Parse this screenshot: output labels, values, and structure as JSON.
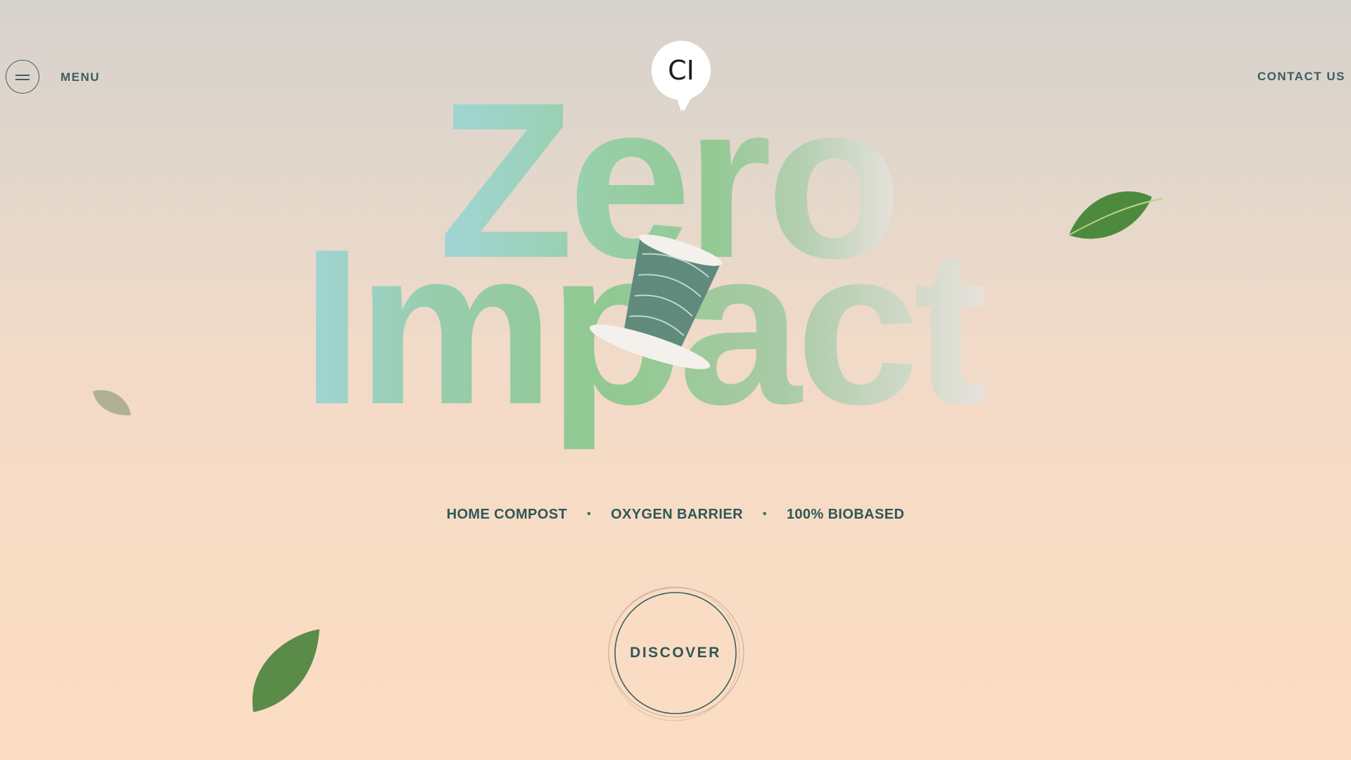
{
  "header": {
    "menu_label": "MENU",
    "contact_label": "CONTACT US",
    "logo_text": "CI"
  },
  "hero": {
    "line1": "Zero",
    "line2": "Impact"
  },
  "features": [
    "HOME COMPOST",
    "OXYGEN BARRIER",
    "100% BIOBASED"
  ],
  "cta": {
    "label": "DISCOVER"
  },
  "colors": {
    "text": "#2e5556",
    "headline_teal": "#9ed4d2",
    "headline_green": "#8fca91",
    "capsule": "#5d8a7a",
    "leaf": "#4f8a3e"
  },
  "icons": {
    "menu": "menu-icon",
    "logo": "speech-bubble-logo",
    "leaf": "leaf-icon",
    "capsule": "coffee-capsule-image"
  }
}
